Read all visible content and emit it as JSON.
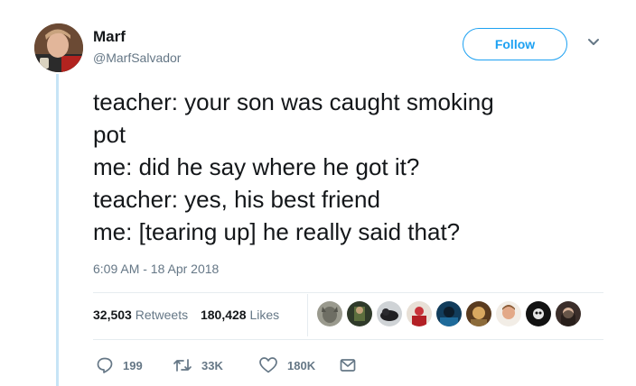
{
  "author": {
    "name": "Marf",
    "handle": "@MarfSalvador"
  },
  "follow_button": {
    "label": "Follow"
  },
  "tweet": {
    "text": "teacher: your son was caught smoking\npot\nme: did he say where he got it?\nteacher: yes, his best friend\nme: [tearing up] he really said that?",
    "timestamp": "6:09 AM - 18 Apr 2018"
  },
  "stats": {
    "retweets_count": "32,503",
    "retweets_label": "Retweets",
    "likes_count": "180,428",
    "likes_label": "Likes"
  },
  "actions": {
    "replies": "199",
    "retweets": "33K",
    "likes": "180K"
  },
  "icons": [
    "chevron-down-icon",
    "reply-icon",
    "retweet-icon",
    "heart-icon",
    "message-icon"
  ],
  "colors": {
    "accent": "#1da1f2",
    "muted": "#657786",
    "text": "#14171a",
    "thread": "#c7e4f6"
  }
}
